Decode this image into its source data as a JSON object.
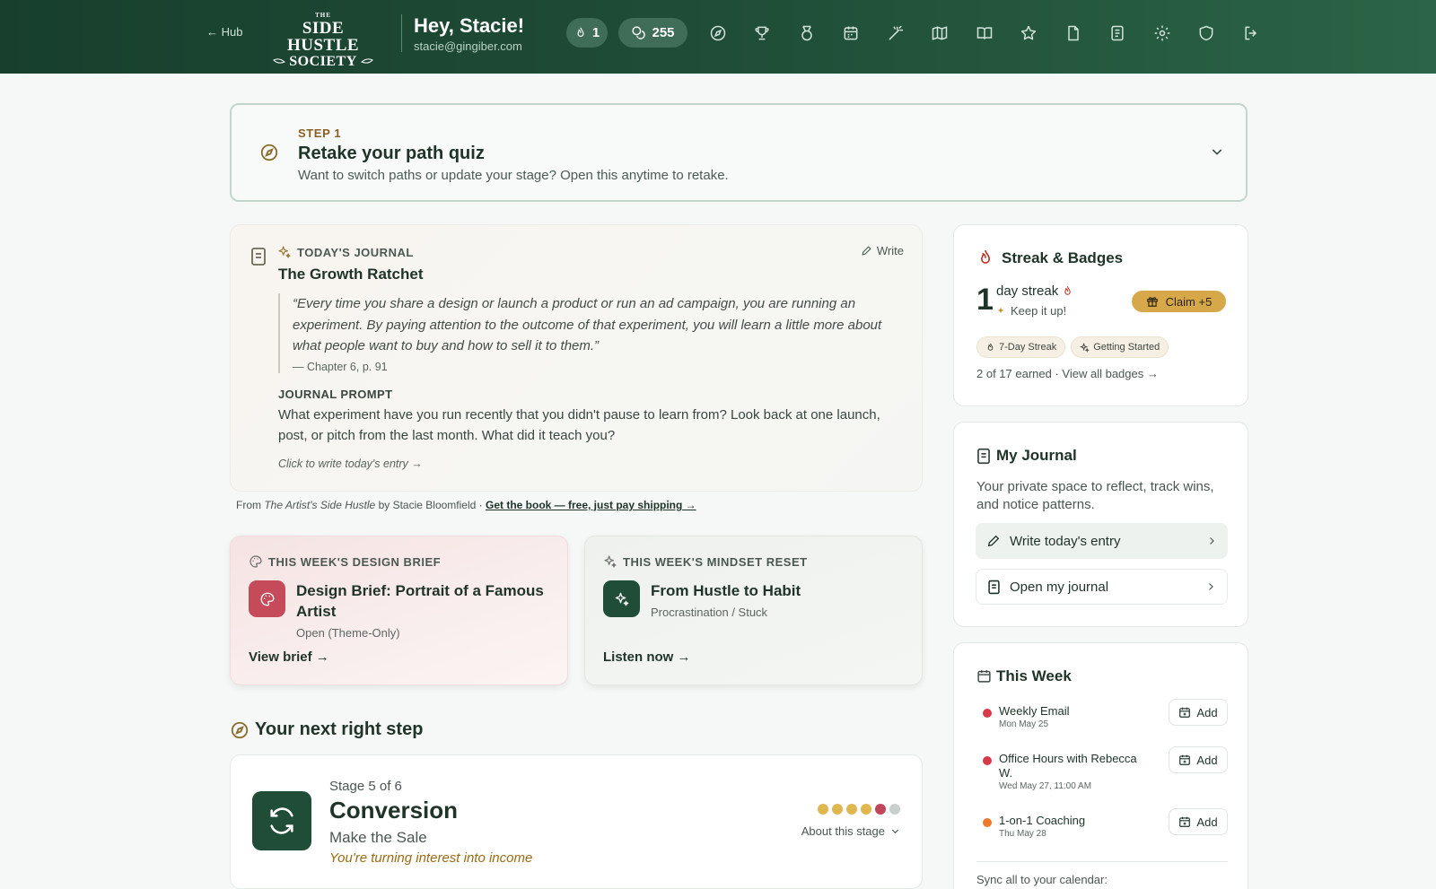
{
  "header": {
    "hub_label": "← Hub",
    "logo": {
      "the": "THE",
      "line1": "SIDE HUSTLE",
      "line2": "SOCIETY"
    },
    "greeting": "Hey, Stacie!",
    "email": "stacie@gingiber.com",
    "streak_count": "1",
    "points": "255",
    "nav_icons": [
      "compass-icon",
      "trophy-icon",
      "medal-icon",
      "calendar-icon",
      "magic-wand-icon",
      "map-icon",
      "book-open-icon",
      "star-icon",
      "file-icon",
      "journal-icon",
      "gear-icon",
      "shield-icon",
      "logout-icon"
    ]
  },
  "step": {
    "label": "STEP 1",
    "title": "Retake your path quiz",
    "subtitle": "Want to switch paths or update your stage? Open this anytime to retake."
  },
  "journal": {
    "label": "TODAY'S JOURNAL",
    "write": "Write",
    "title": "The Growth Ratchet",
    "quote": "“Every time you share a design or launch a product or run an ad campaign, you are running an experiment. By paying attention to the outcome of that experiment, you will learn a little more about what people want to buy and how to sell it to them.”",
    "cite": "— Chapter 6, p. 91",
    "prompt_label": "JOURNAL PROMPT",
    "prompt": "What experiment have you run recently that you didn't pause to learn from? Look back at one launch, post, or pitch from the last month. What did it teach you?",
    "cta": "Click to write today's entry →"
  },
  "from_line": {
    "prefix": "From",
    "book": "The Artist's Side Hustle",
    "author": "by Stacie Bloomfield ·",
    "link": "Get the book — free, just pay shipping →"
  },
  "design_brief": {
    "label": "THIS WEEK'S DESIGN BRIEF",
    "title": "Design Brief: Portrait of a Famous Artist",
    "sub": "Open (Theme-Only)",
    "link": "View brief →"
  },
  "mindset": {
    "label": "THIS WEEK'S MINDSET RESET",
    "title": "From Hustle to Habit",
    "sub": "Procrastination / Stuck",
    "link": "Listen now →"
  },
  "next_step": {
    "title": "Your next right step",
    "stage_of": "Stage 5 of 6",
    "stage_name": "Conversion",
    "stage_desc": "Make the Sale",
    "tagline": "You're turning interest into income",
    "about": "About this stage",
    "progress_dots": [
      "#e0b64f",
      "#e0b64f",
      "#e0b64f",
      "#e0b64f",
      "#c2465a",
      "#c9cfcc"
    ]
  },
  "streak": {
    "title": "Streak & Badges",
    "count": "1",
    "label": "day streak",
    "keep": "Keep it up!",
    "claim": "Claim +5",
    "badges": [
      "7-Day Streak",
      "Getting Started"
    ],
    "earned": "2 of 17 earned ·",
    "view_all": "View all badges →"
  },
  "my_journal": {
    "title": "My Journal",
    "subtitle": "Your private space to reflect, track wins, and notice patterns.",
    "write_btn": "Write today's entry",
    "open_btn": "Open my journal"
  },
  "week": {
    "title": "This Week",
    "events": [
      {
        "title": "Weekly Email",
        "date": "Mon May 25",
        "color": "#d83a4a"
      },
      {
        "title": "Office Hours with Rebecca W.",
        "date": "Wed May 27, 11:00 AM",
        "color": "#d83a4a"
      },
      {
        "title": "1-on-1 Coaching",
        "date": "Thu May 28",
        "color": "#ee7a2a"
      }
    ],
    "add_label": "Add",
    "sync": "Sync all to your calendar:"
  },
  "colors": {
    "header_bg": "#1f4d37",
    "accent_gold": "#d7a84a",
    "brand_green": "#1f4d37",
    "design_tile": "#c64b5a",
    "mindset_tile": "#1f4d37"
  }
}
